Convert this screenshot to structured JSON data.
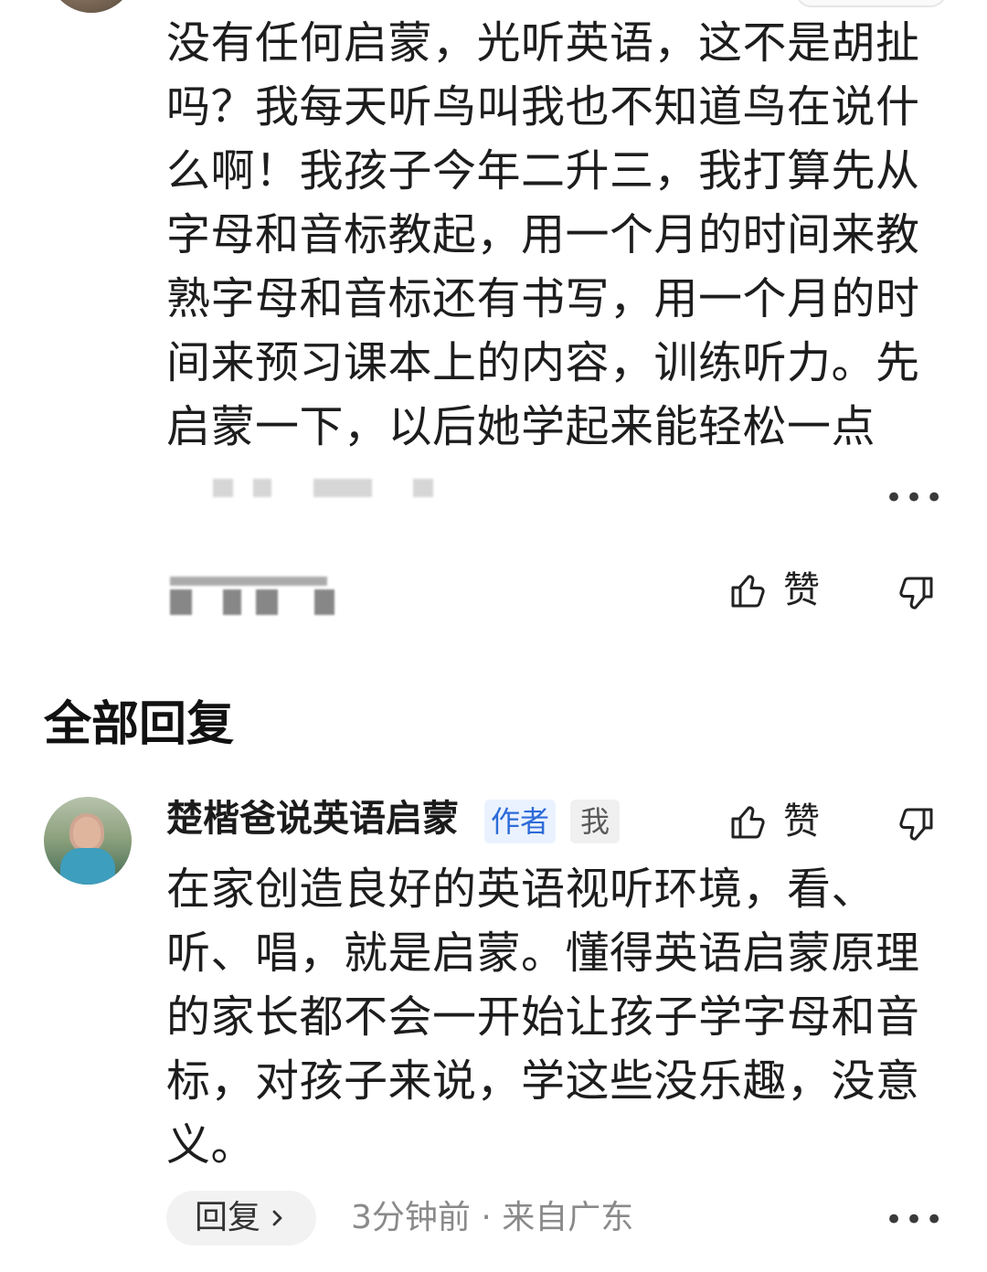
{
  "top_comment": {
    "text": "没有任何启蒙，光听英语，这不是胡扯吗？我每天听鸟叫我也不知道鸟在说什么啊！我孩子今年二升三，我打算先从字母和音标教起，用一个月的时间来教熟字母和音标还有书写，用一个月的时间来预习课本上的内容，训练听力。先启蒙一下，以后她学起来能轻松一点",
    "like_label": "赞",
    "more_label": "•••",
    "icons": {
      "like": "thumbs-up-icon",
      "dislike": "thumbs-down-icon"
    }
  },
  "replies_section": {
    "title": "全部回复"
  },
  "reply": {
    "author": "楚楷爸说英语启蒙",
    "badges": {
      "author": "作者",
      "me": "我"
    },
    "like_label": "赞",
    "text": "在家创造良好的英语视听环境，看、听、唱，就是启蒙。懂得英语启蒙原理的家长都不会一开始让孩子学字母和音标，对孩子来说，学这些没乐趣，没意义。",
    "reply_button": "回复",
    "time_location": "3分钟前 · 来自广东",
    "more_label": "•••",
    "icons": {
      "like": "thumbs-up-icon",
      "dislike": "thumbs-down-icon",
      "chevron": "chevron-right-icon"
    }
  },
  "colors": {
    "badge_author_bg": "#eaf2ff",
    "badge_author_text": "#2d6bd8",
    "meta_text": "#8a8a8a"
  }
}
